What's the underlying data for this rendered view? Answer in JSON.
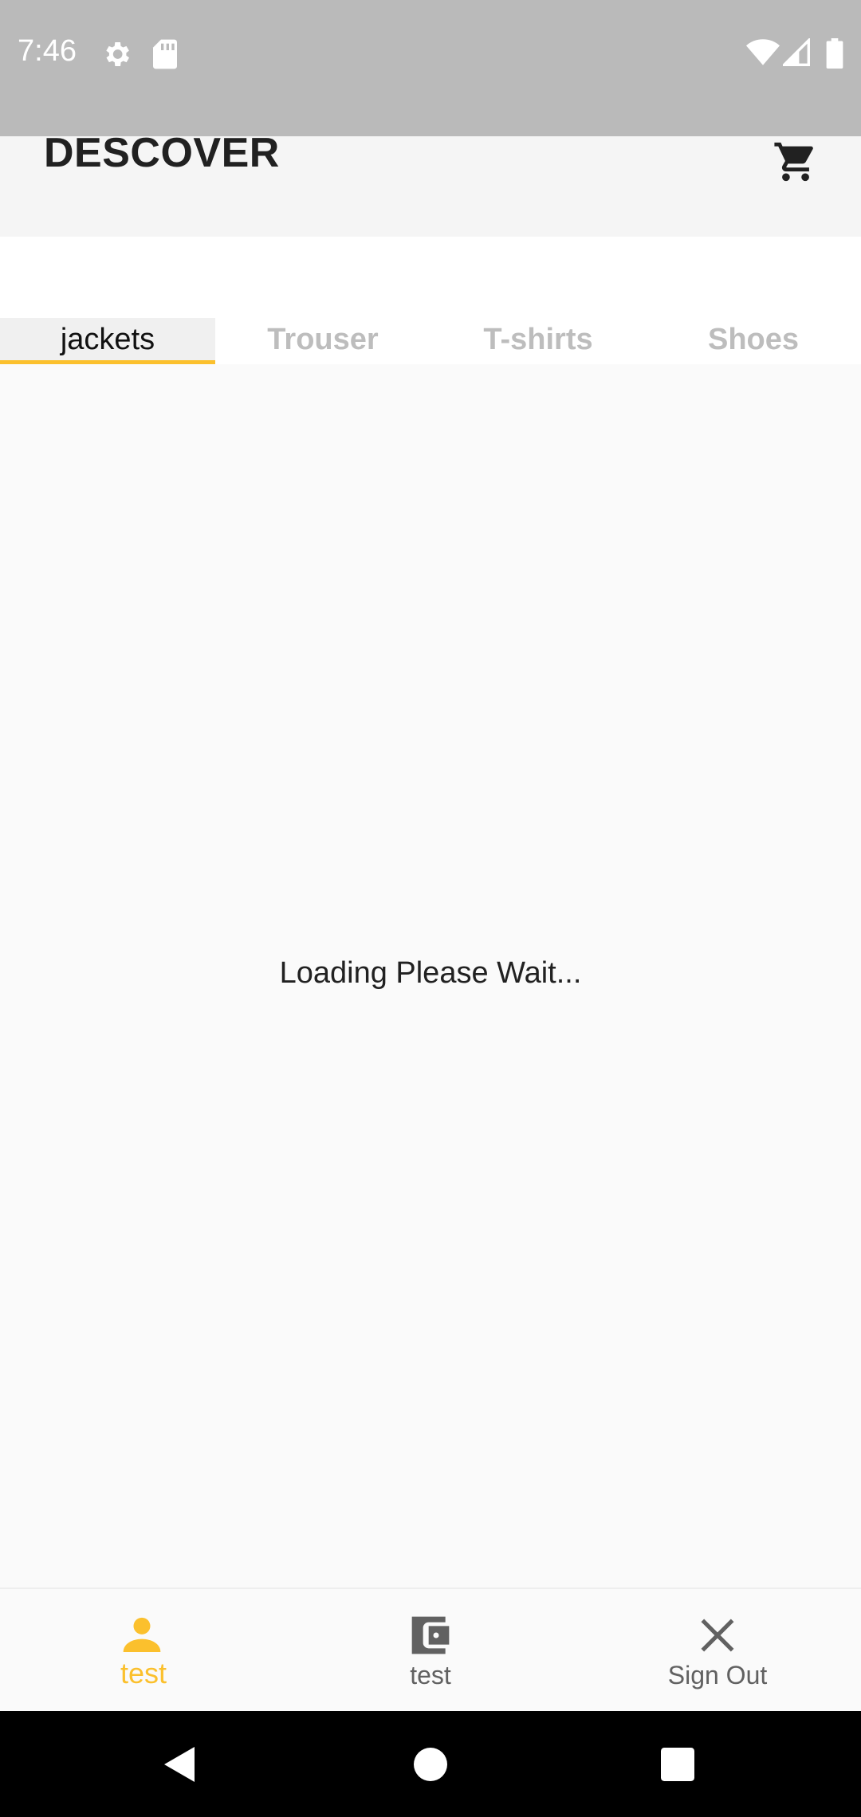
{
  "status_bar": {
    "time": "7:46",
    "icons": [
      "gear-icon",
      "sd-card-icon",
      "wifi-icon",
      "cell-signal-icon",
      "battery-icon"
    ]
  },
  "app_bar": {
    "title": "DESCOVER",
    "cart_icon": "shopping-cart-icon"
  },
  "tabs": [
    {
      "label": "jackets",
      "active": true
    },
    {
      "label": "Trouser",
      "active": false
    },
    {
      "label": "T-shirts",
      "active": false
    },
    {
      "label": "Shoes",
      "active": false
    }
  ],
  "content": {
    "loading_text": "Loading Please Wait..."
  },
  "bottom_nav": [
    {
      "label": "test",
      "icon": "person-icon",
      "active": true
    },
    {
      "label": "test",
      "icon": "wallet-icon",
      "active": false
    },
    {
      "label": "Sign Out",
      "icon": "close-icon",
      "active": false
    }
  ],
  "colors": {
    "accent": "#fbc02d",
    "status_bar": "#bababa",
    "inactive_tab": "#bdbdbd"
  }
}
